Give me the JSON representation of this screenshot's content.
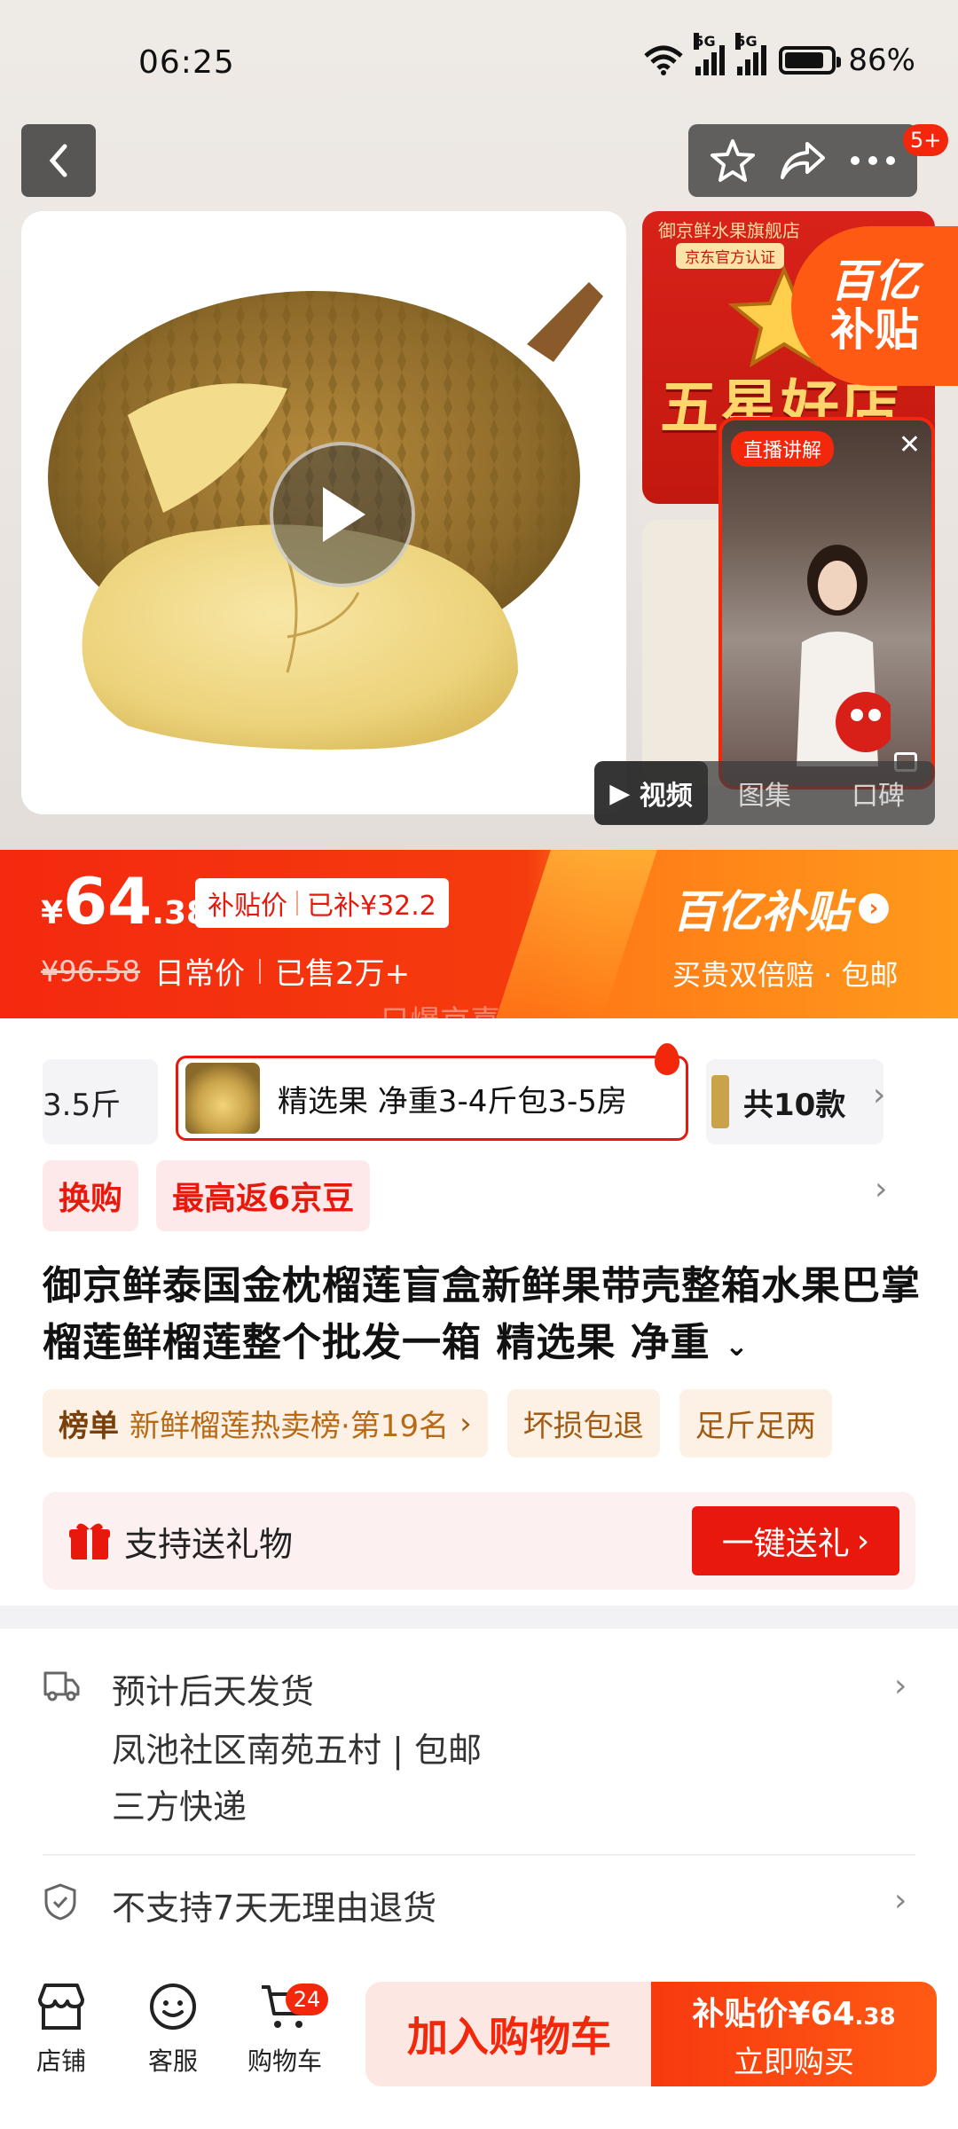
{
  "status": {
    "time": "06:25",
    "net1": "5G",
    "net2": "5G",
    "battery": "86%",
    "battery_level": 0.86
  },
  "nav": {
    "cart_badge": "5+"
  },
  "gallery": {
    "thumb_shop": "御京鲜水果旗舰店",
    "thumb_cert": "京东官方认证",
    "thumb_headline": "五星好店",
    "subsidy_badge_l1": "百亿",
    "subsidy_badge_l2": "补贴",
    "live_tag": "直播讲解",
    "tabs": [
      "视频",
      "图集",
      "口碑"
    ]
  },
  "price": {
    "currency": "¥",
    "int": "64",
    "dec": ".38",
    "subsidy_label": "补贴价",
    "subsidy_saved": "已补¥32.2",
    "original": "¥96.58",
    "daily_label": "日常价",
    "sold": "已售2万+",
    "brand": "百亿补贴",
    "brand_sub": "买贵双倍赔 · 包邮",
    "ghost": "只爆京喜"
  },
  "sku": {
    "prev": "3.5斤",
    "selected": "精选果 净重3-4斤包3-5房",
    "total": "共10款"
  },
  "promos": [
    "换购",
    "最高返6京豆"
  ],
  "product": {
    "title": "御京鲜泰国金枕榴莲盲盒新鲜果带壳整箱水果巴掌榴莲鲜榴莲整个批发一箱 精选果 净重"
  },
  "chips": {
    "rank_label": "榜单",
    "rank_text": "新鲜榴莲热卖榜·第19名",
    "c1": "坏损包退",
    "c2": "足斤足两"
  },
  "gift": {
    "text": "支持送礼物",
    "button": "一键送礼"
  },
  "shipping": {
    "l1": "预计后天发货",
    "l2": "凤池社区南苑五村 | 包邮",
    "l3": "三方快递",
    "returns": "不支持7天无理由退货"
  },
  "bottom": {
    "store": "店铺",
    "service": "客服",
    "cart": "购物车",
    "cart_count": "24",
    "add_cart": "加入购物车",
    "buy_label": "补贴价¥64",
    "buy_dec": ".38",
    "buy_now": "立即购买"
  },
  "colors": {
    "accent": "#f2270c",
    "orange": "#ff7a16",
    "gold": "#a05c14"
  }
}
